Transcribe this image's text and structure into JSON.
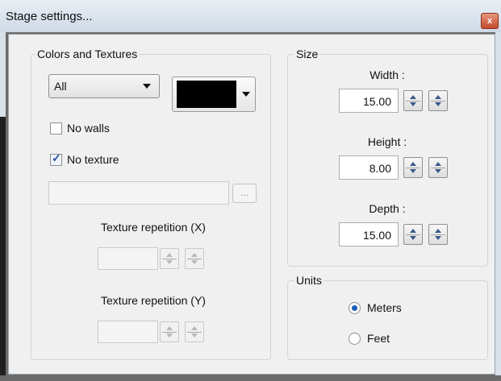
{
  "window": {
    "title": "Stage settings...",
    "close_label": "x"
  },
  "colors": {
    "group_label": "Colors and Textures",
    "target_combo": "All",
    "swatch_color": "#000000",
    "no_walls": {
      "label": "No walls",
      "checked": false
    },
    "no_texture": {
      "label": "No texture",
      "checked": true
    },
    "texture_path": {
      "value": ""
    },
    "browse_label": "...",
    "rep_x": {
      "label": "Texture repetition (X)",
      "value": ""
    },
    "rep_y": {
      "label": "Texture repetition (Y)",
      "value": ""
    }
  },
  "size": {
    "group_label": "Size",
    "width": {
      "label": "Width :",
      "value": "15.00"
    },
    "height": {
      "label": "Height :",
      "value": "8.00"
    },
    "depth": {
      "label": "Depth :",
      "value": "15.00"
    }
  },
  "units": {
    "group_label": "Units",
    "meters": {
      "label": "Meters",
      "selected": true
    },
    "feet": {
      "label": "Feet",
      "selected": false
    }
  },
  "icons": [
    "close-icon",
    "dropdown-arrow-icon",
    "checkbox-checked-icon",
    "spin-up-icon",
    "spin-down-icon",
    "radio-selected-icon"
  ]
}
